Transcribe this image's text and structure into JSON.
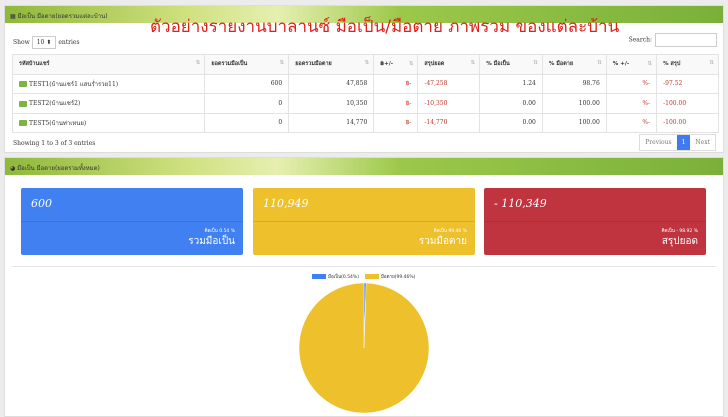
{
  "title": "ตัวอย่างรายงานบาลานซ์ มือเป็น/มือตาย ภาพรวม ของแต่ละบ้าน",
  "panel1": {
    "header": "มือเป็น มือตาย(ยอดรวมแต่ละบ้าน)",
    "show": "Show",
    "entries_value": "10",
    "entries": "entries",
    "search": "Search:",
    "columns": [
      "รหัสบ้านแชร์",
      "ยอดรวมมือเป็น",
      "ยอดรวมมือตาย",
      "฿+/-",
      "สรุปยอด",
      "% มือเป็น",
      "% มือตาย",
      "% +/-",
      "% สรุป"
    ],
    "rows": [
      {
        "name": "TEST1(บ้านแชร์1 แสนร่ำรวย11)",
        "live": "600",
        "dead": "47,858",
        "sign": "฿-",
        "sum": "-47,258",
        "pl": "1.24",
        "pd": "98.76",
        "psign": "%-",
        "ps": "-97.52"
      },
      {
        "name": "TEST2(บ้านแชร์2)",
        "live": "0",
        "dead": "10,350",
        "sign": "฿-",
        "sum": "-10,350",
        "pl": "0.00",
        "pd": "100.00",
        "psign": "%-",
        "ps": "-100.00"
      },
      {
        "name": "TEST5(บ้านท่าเหนย)",
        "live": "0",
        "dead": "14,770",
        "sign": "฿-",
        "sum": "-14,770",
        "pl": "0.00",
        "pd": "100.00",
        "psign": "%-",
        "ps": "-100.00"
      }
    ],
    "info": "Showing 1 to 3 of 3 entries",
    "prev": "Previous",
    "page": "1",
    "next": "Next"
  },
  "panel2": {
    "header": "มือเป็น มือตาย(ยอดรวมทั้งหมด)",
    "cards": [
      {
        "value": "600",
        "pct": "คิดเป็น 0.54 %",
        "label": "รวมมือเป็น",
        "color": "#4080f0"
      },
      {
        "value": "110,949",
        "pct": "คิดเป็น 99.46 %",
        "label": "รวมมือตาย",
        "color": "#eec02c"
      },
      {
        "value": "- 110,349",
        "pct": "คิดเป็น - 98.92 %",
        "label": "สรุปยอด",
        "color": "#c03440"
      }
    ],
    "legend": [
      "มือเป็น(0.54%)",
      "มือตาย(99.46%)"
    ]
  },
  "chart_data": {
    "type": "pie",
    "categories": [
      "มือเป็น",
      "มือตาย"
    ],
    "values": [
      0.54,
      99.46
    ],
    "colors": [
      "#4080f0",
      "#eec02c"
    ],
    "legend": "top"
  }
}
